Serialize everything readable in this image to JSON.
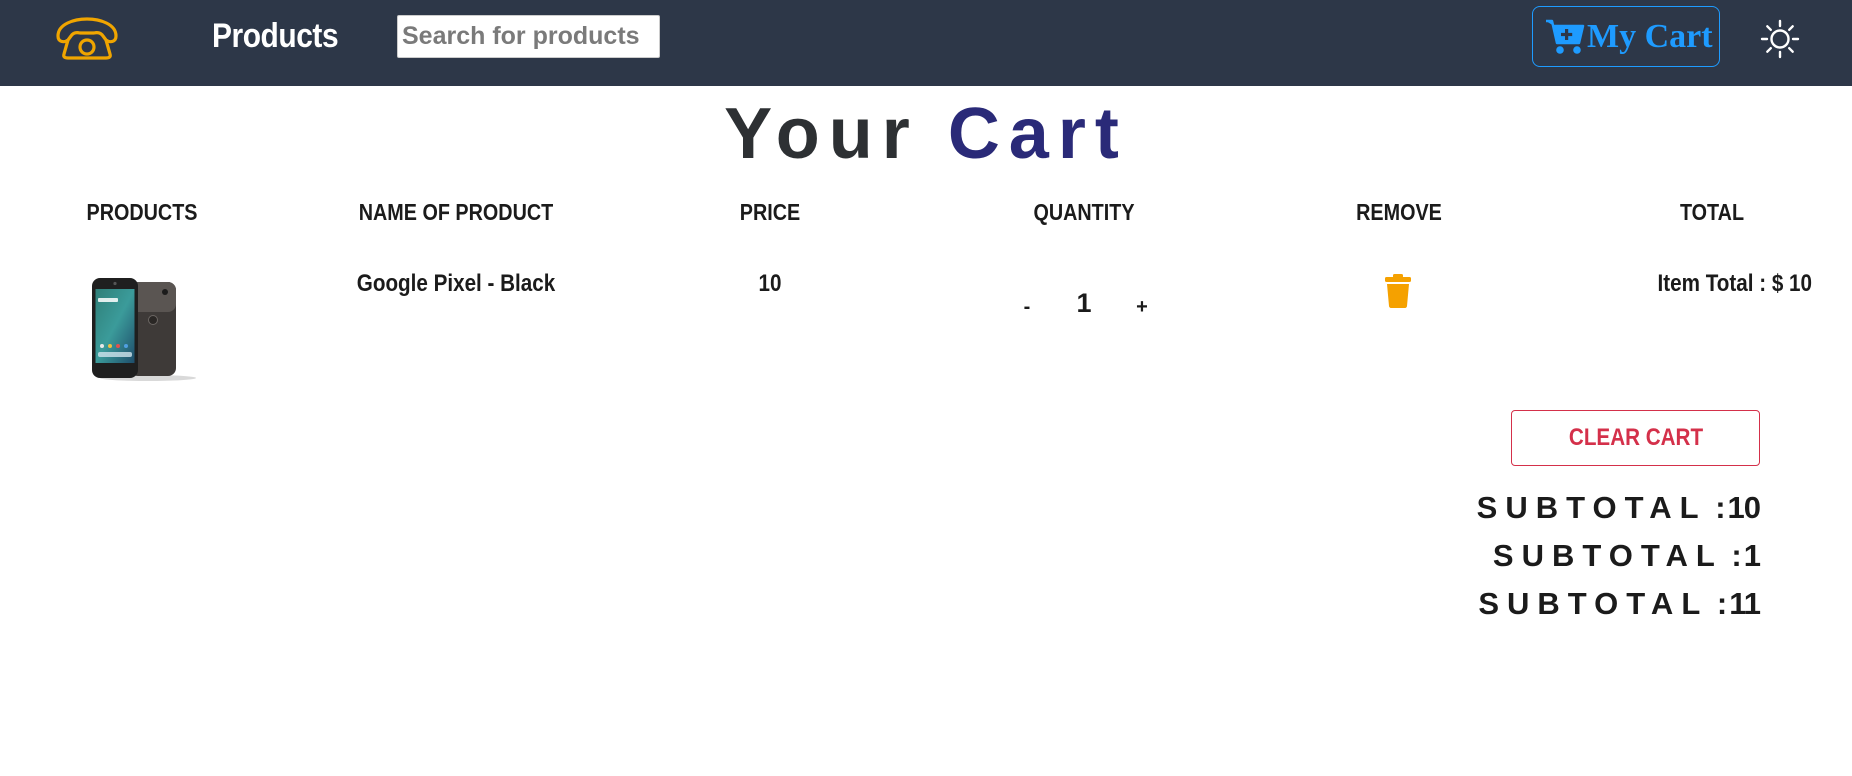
{
  "navbar": {
    "products_link": "Products",
    "search_placeholder": "Search for products",
    "cart_label": "My Cart",
    "colors": {
      "background": "#2d3748",
      "logo": "#f0a500",
      "cart": "#1e9bff"
    },
    "icons": {
      "logo": "telephone-icon",
      "cart": "cart-plus-icon",
      "theme": "sun-icon"
    }
  },
  "page_title": {
    "part1": "Your",
    "part2": "Cart"
  },
  "table": {
    "headers": {
      "products": "PRODUCTS",
      "name": "NAME OF PRODUCT",
      "price": "PRICE",
      "quantity": "QUANTITY",
      "remove": "REMOVE",
      "total": "TOTAL"
    },
    "rows": [
      {
        "name": "Google Pixel - Black",
        "price": "10",
        "quantity": "1",
        "decrement": "-",
        "increment": "+",
        "item_total": "Item Total : $ 10",
        "remove_icon": "trash-icon"
      }
    ]
  },
  "summary": {
    "clear_label": "CLEAR CART",
    "lines": [
      {
        "label": "SUBTOTAL",
        "sep": ":",
        "value": "10"
      },
      {
        "label": "SUBTOTAL",
        "sep": ":",
        "value": "1"
      },
      {
        "label": "SUBTOTAL",
        "sep": ":",
        "value": "11"
      }
    ],
    "colors": {
      "clear": "#d4304a",
      "trash": "#f5a100"
    }
  }
}
